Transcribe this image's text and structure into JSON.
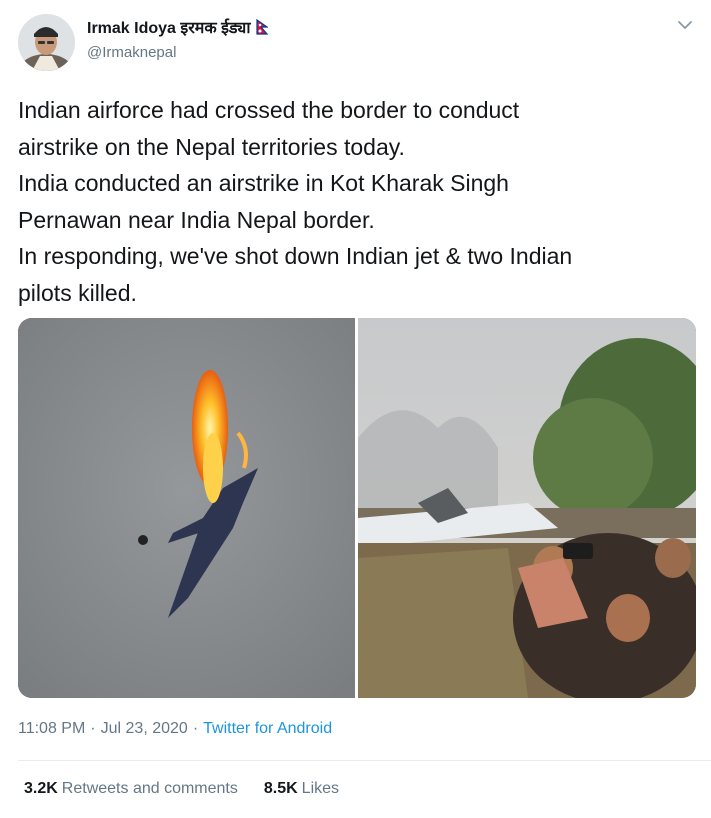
{
  "user": {
    "display_name": "Irmak Idoya इरमक ईड्या",
    "handle": "@Irmaknepal"
  },
  "tweet": {
    "text": "Indian airforce had crossed the border to conduct\nairstrike on the Nepal territories today.\nIndia conducted an airstrike in Kot Kharak Singh\nPernawan near India Nepal border.\nIn responding, we've shot down Indian jet & two Indian\npilots killed.",
    "time": "11:08 PM",
    "date": "Jul 23, 2020",
    "source": "Twitter for Android"
  },
  "stats": {
    "retweets_count": "3.2K",
    "retweets_label": "Retweets and comments",
    "likes_count": "8.5K",
    "likes_label": "Likes"
  },
  "colors": {
    "text": "#14171a",
    "secondary": "#657786",
    "link": "#1b95e0",
    "nepal_flag_red": "#dc143c",
    "nepal_flag_blue": "#003893"
  },
  "icons": {
    "more": "chevron-down-icon",
    "flag": "nepal-flag-icon"
  }
}
